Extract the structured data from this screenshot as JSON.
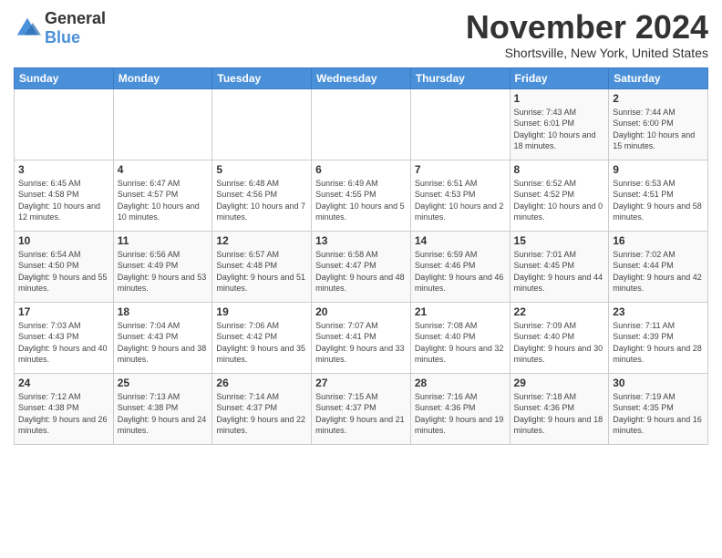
{
  "logo": {
    "general": "General",
    "blue": "Blue"
  },
  "header": {
    "month": "November 2024",
    "location": "Shortsville, New York, United States"
  },
  "days_of_week": [
    "Sunday",
    "Monday",
    "Tuesday",
    "Wednesday",
    "Thursday",
    "Friday",
    "Saturday"
  ],
  "weeks": [
    [
      {
        "day": "",
        "info": ""
      },
      {
        "day": "",
        "info": ""
      },
      {
        "day": "",
        "info": ""
      },
      {
        "day": "",
        "info": ""
      },
      {
        "day": "",
        "info": ""
      },
      {
        "day": "1",
        "info": "Sunrise: 7:43 AM\nSunset: 6:01 PM\nDaylight: 10 hours and 18 minutes."
      },
      {
        "day": "2",
        "info": "Sunrise: 7:44 AM\nSunset: 6:00 PM\nDaylight: 10 hours and 15 minutes."
      }
    ],
    [
      {
        "day": "3",
        "info": "Sunrise: 6:45 AM\nSunset: 4:58 PM\nDaylight: 10 hours and 12 minutes."
      },
      {
        "day": "4",
        "info": "Sunrise: 6:47 AM\nSunset: 4:57 PM\nDaylight: 10 hours and 10 minutes."
      },
      {
        "day": "5",
        "info": "Sunrise: 6:48 AM\nSunset: 4:56 PM\nDaylight: 10 hours and 7 minutes."
      },
      {
        "day": "6",
        "info": "Sunrise: 6:49 AM\nSunset: 4:55 PM\nDaylight: 10 hours and 5 minutes."
      },
      {
        "day": "7",
        "info": "Sunrise: 6:51 AM\nSunset: 4:53 PM\nDaylight: 10 hours and 2 minutes."
      },
      {
        "day": "8",
        "info": "Sunrise: 6:52 AM\nSunset: 4:52 PM\nDaylight: 10 hours and 0 minutes."
      },
      {
        "day": "9",
        "info": "Sunrise: 6:53 AM\nSunset: 4:51 PM\nDaylight: 9 hours and 58 minutes."
      }
    ],
    [
      {
        "day": "10",
        "info": "Sunrise: 6:54 AM\nSunset: 4:50 PM\nDaylight: 9 hours and 55 minutes."
      },
      {
        "day": "11",
        "info": "Sunrise: 6:56 AM\nSunset: 4:49 PM\nDaylight: 9 hours and 53 minutes."
      },
      {
        "day": "12",
        "info": "Sunrise: 6:57 AM\nSunset: 4:48 PM\nDaylight: 9 hours and 51 minutes."
      },
      {
        "day": "13",
        "info": "Sunrise: 6:58 AM\nSunset: 4:47 PM\nDaylight: 9 hours and 48 minutes."
      },
      {
        "day": "14",
        "info": "Sunrise: 6:59 AM\nSunset: 4:46 PM\nDaylight: 9 hours and 46 minutes."
      },
      {
        "day": "15",
        "info": "Sunrise: 7:01 AM\nSunset: 4:45 PM\nDaylight: 9 hours and 44 minutes."
      },
      {
        "day": "16",
        "info": "Sunrise: 7:02 AM\nSunset: 4:44 PM\nDaylight: 9 hours and 42 minutes."
      }
    ],
    [
      {
        "day": "17",
        "info": "Sunrise: 7:03 AM\nSunset: 4:43 PM\nDaylight: 9 hours and 40 minutes."
      },
      {
        "day": "18",
        "info": "Sunrise: 7:04 AM\nSunset: 4:43 PM\nDaylight: 9 hours and 38 minutes."
      },
      {
        "day": "19",
        "info": "Sunrise: 7:06 AM\nSunset: 4:42 PM\nDaylight: 9 hours and 35 minutes."
      },
      {
        "day": "20",
        "info": "Sunrise: 7:07 AM\nSunset: 4:41 PM\nDaylight: 9 hours and 33 minutes."
      },
      {
        "day": "21",
        "info": "Sunrise: 7:08 AM\nSunset: 4:40 PM\nDaylight: 9 hours and 32 minutes."
      },
      {
        "day": "22",
        "info": "Sunrise: 7:09 AM\nSunset: 4:40 PM\nDaylight: 9 hours and 30 minutes."
      },
      {
        "day": "23",
        "info": "Sunrise: 7:11 AM\nSunset: 4:39 PM\nDaylight: 9 hours and 28 minutes."
      }
    ],
    [
      {
        "day": "24",
        "info": "Sunrise: 7:12 AM\nSunset: 4:38 PM\nDaylight: 9 hours and 26 minutes."
      },
      {
        "day": "25",
        "info": "Sunrise: 7:13 AM\nSunset: 4:38 PM\nDaylight: 9 hours and 24 minutes."
      },
      {
        "day": "26",
        "info": "Sunrise: 7:14 AM\nSunset: 4:37 PM\nDaylight: 9 hours and 22 minutes."
      },
      {
        "day": "27",
        "info": "Sunrise: 7:15 AM\nSunset: 4:37 PM\nDaylight: 9 hours and 21 minutes."
      },
      {
        "day": "28",
        "info": "Sunrise: 7:16 AM\nSunset: 4:36 PM\nDaylight: 9 hours and 19 minutes."
      },
      {
        "day": "29",
        "info": "Sunrise: 7:18 AM\nSunset: 4:36 PM\nDaylight: 9 hours and 18 minutes."
      },
      {
        "day": "30",
        "info": "Sunrise: 7:19 AM\nSunset: 4:35 PM\nDaylight: 9 hours and 16 minutes."
      }
    ]
  ]
}
